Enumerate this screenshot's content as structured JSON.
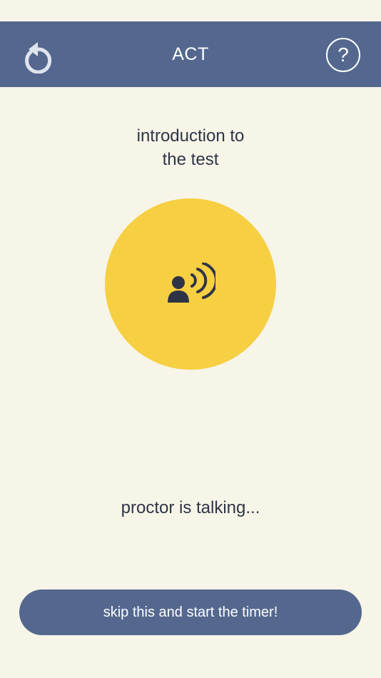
{
  "header": {
    "title": "ACT",
    "help_symbol": "?",
    "back_icon": "refresh-back-icon",
    "background_color": "#54688f"
  },
  "section": {
    "title_line1": "introduction to",
    "title_line2": "the test"
  },
  "proctor": {
    "icon": "person-speaking-icon",
    "circle_color": "#f7cf42",
    "status": "proctor is talking..."
  },
  "actions": {
    "skip_label": "skip this and start the timer!"
  },
  "colors": {
    "background": "#f7f5e8",
    "text": "#2e3446",
    "accent": "#54688f",
    "highlight": "#f7cf42"
  }
}
